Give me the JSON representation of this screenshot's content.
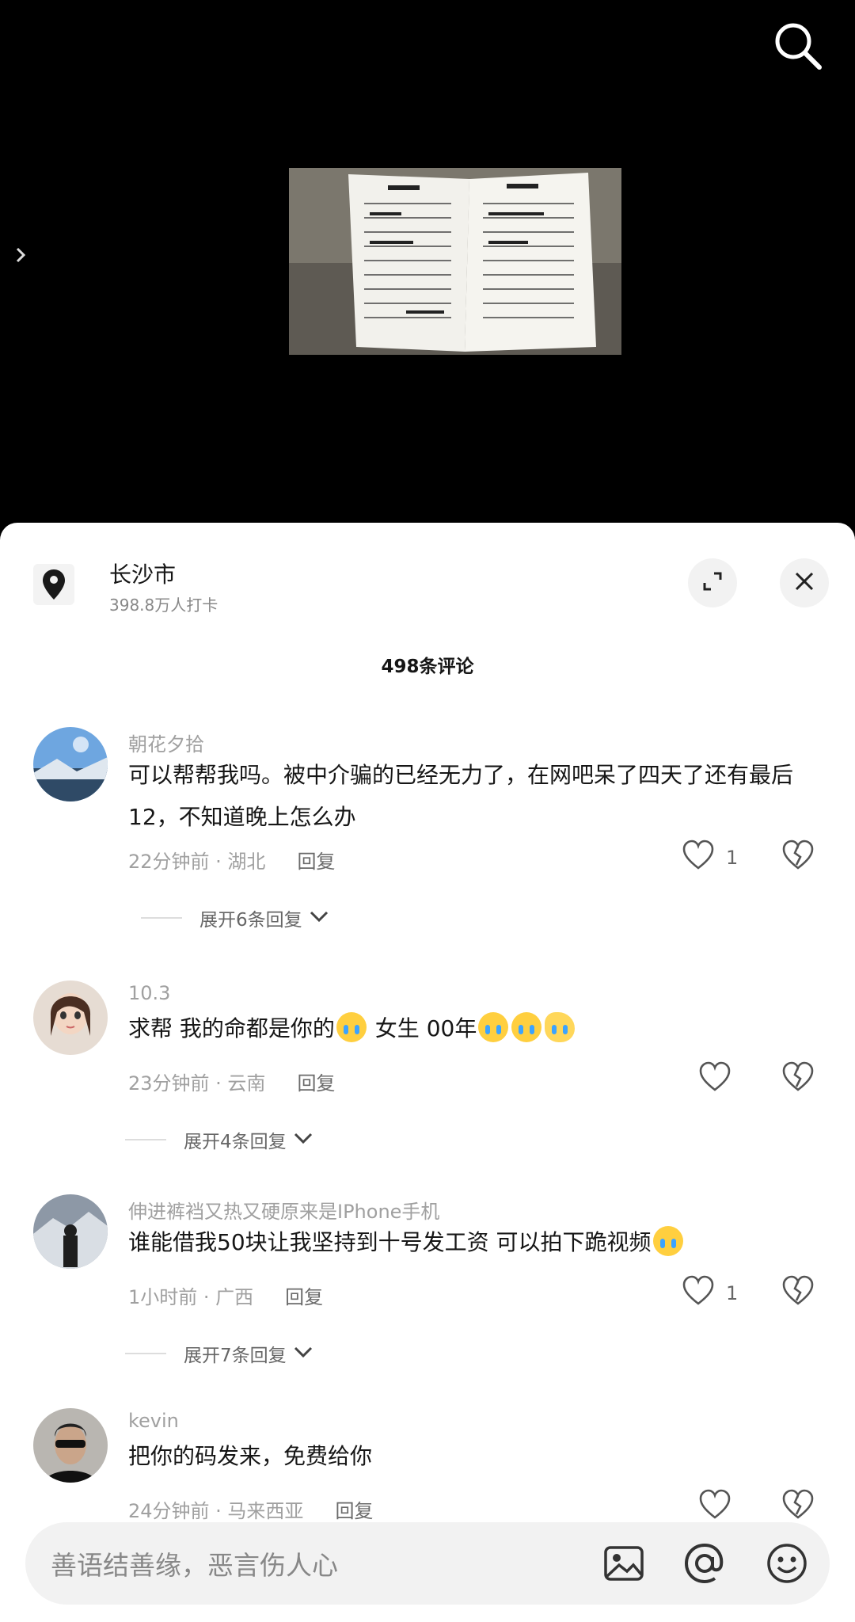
{
  "location": {
    "name": "长沙市",
    "checkins": "398.8万人打卡"
  },
  "comment_count": "498条评论",
  "comments": [
    {
      "user": "朝花夕拾",
      "text": "可以帮帮我吗。被中介骗的已经无力了，在网吧呆了四天了还有最后12，不知道晚上怎么办",
      "time": "22分钟前 · 湖北",
      "reply": "回复",
      "likes": "1",
      "expand": "展开6条回复"
    },
    {
      "user": "10.3",
      "text_parts": [
        "求帮 我的命都是你的",
        " 女生 00年"
      ],
      "time": "23分钟前 · 云南",
      "reply": "回复",
      "likes": "",
      "expand": "展开4条回复"
    },
    {
      "user": "伸进裤裆又热又硬原来是IPhone手机",
      "text": "谁能借我50块让我坚持到十号发工资 可以拍下跪视频",
      "time": "1小时前 · 广西",
      "reply": "回复",
      "likes": "1",
      "expand": "展开7条回复"
    },
    {
      "user": "kevin",
      "text": "把你的码发来，免费给你",
      "time": "24分钟前 · 马来西亚",
      "reply": "回复",
      "likes": ""
    }
  ],
  "input": {
    "placeholder": "善语结善缘，恶言伤人心"
  },
  "colors": {
    "sheet_bg": "#ffffff",
    "text_primary": "#161616",
    "text_secondary": "#a0a0a0"
  }
}
